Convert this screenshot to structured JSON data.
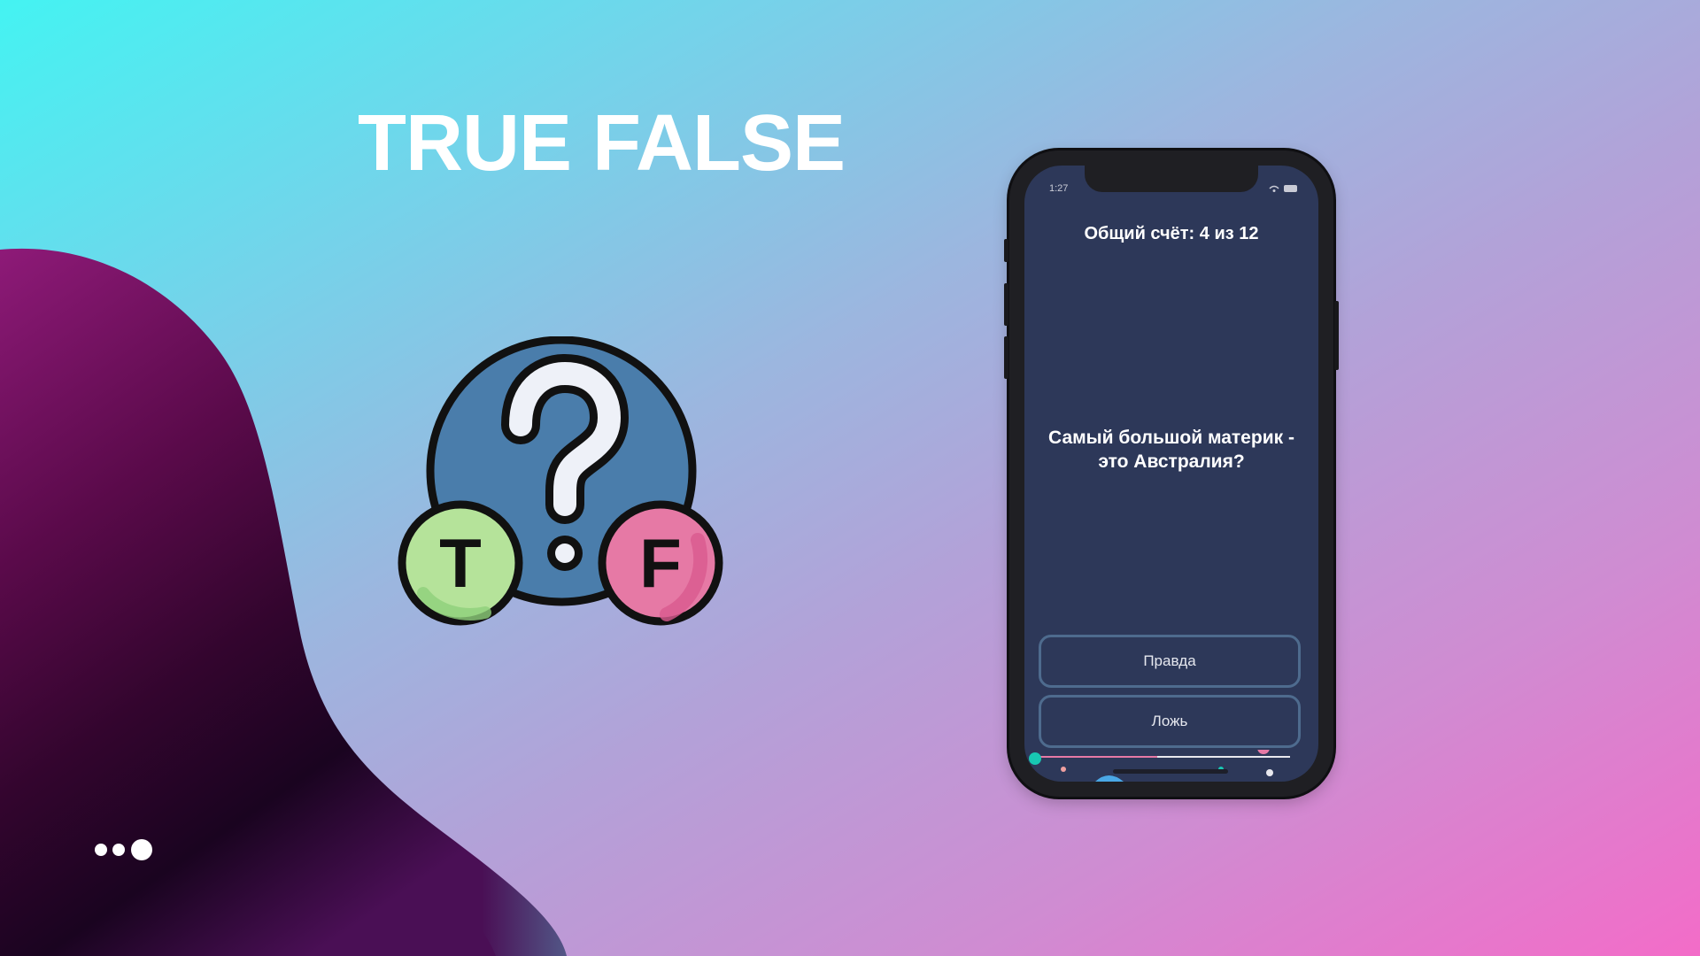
{
  "title": "TRUE FALSE",
  "logo": {
    "left_letter": "T",
    "right_letter": "F",
    "icon": "question-mark-icon"
  },
  "dots_icon": "three-dots-icon",
  "phone": {
    "status_time": "1:27",
    "score_text": "Общий счёт: 4 из 12",
    "question_text": "Самый большой материк - это Австралия?",
    "true_label": "Правда",
    "false_label": "Ложь"
  },
  "colors": {
    "screen_bg": "#2d3859",
    "button_border": "#4e6b8e",
    "true_green": "#b5e39a",
    "false_pink": "#e679a5",
    "badge_blue": "#4a7dab"
  }
}
